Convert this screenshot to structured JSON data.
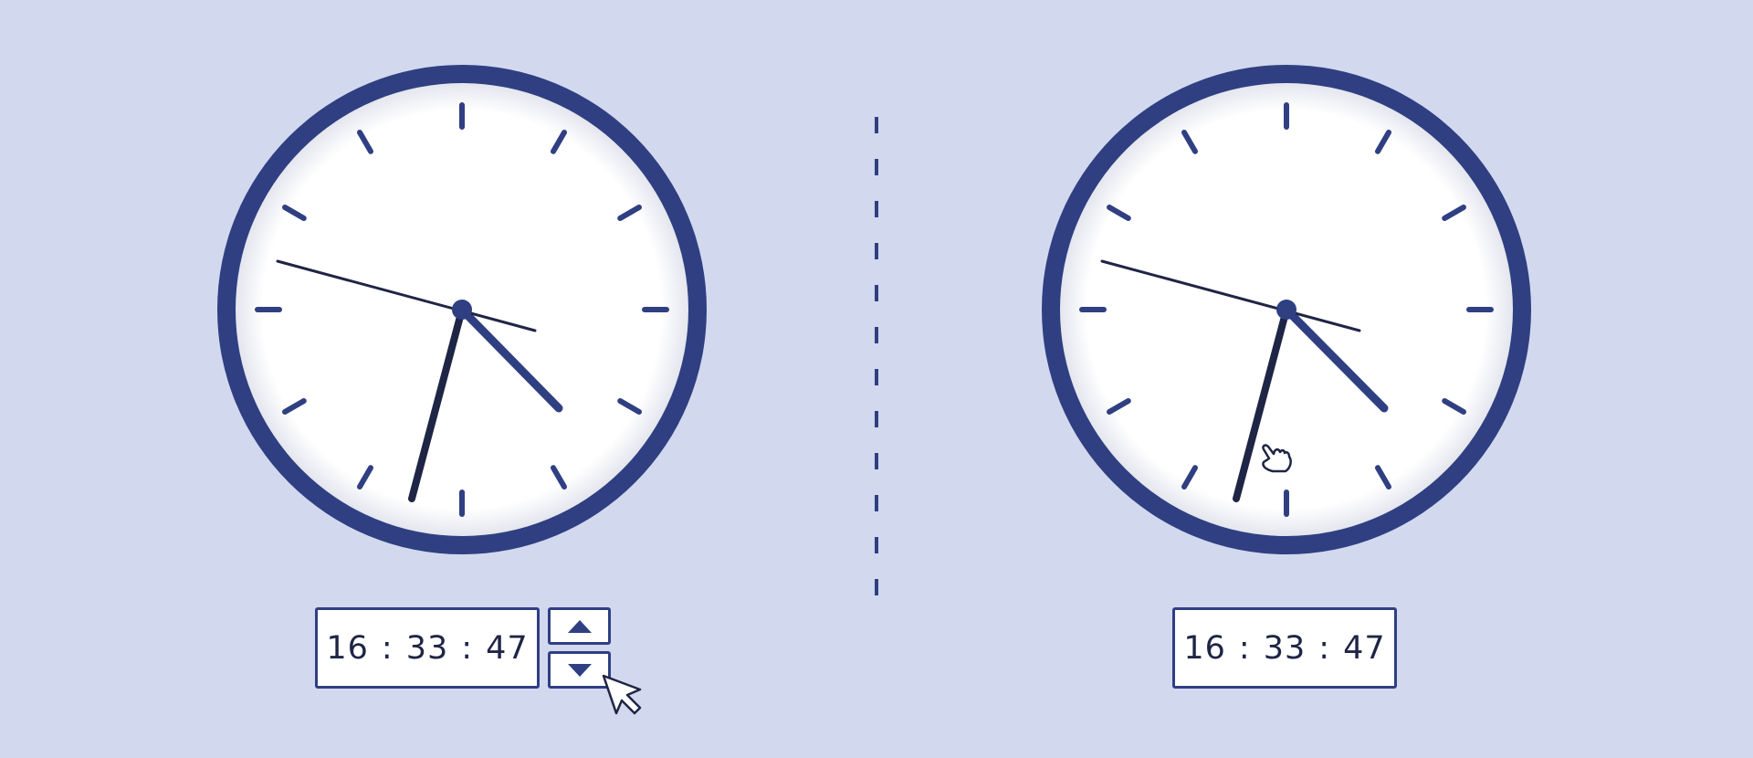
{
  "left_clock": {
    "time": {
      "hours": "16",
      "minutes": "33",
      "seconds": "47",
      "separator": ":"
    },
    "stepper": {
      "up": "triangle-up-icon",
      "down": "triangle-down-icon"
    }
  },
  "right_clock": {
    "time": {
      "hours": "16",
      "minutes": "33",
      "seconds": "47",
      "separator": ":"
    }
  },
  "colors": {
    "background": "#d2d9ee",
    "clock_rim": "#2f3f82",
    "clock_face": "#ffffff",
    "hands": "#1f2545",
    "ticks": "#2f3f82"
  }
}
